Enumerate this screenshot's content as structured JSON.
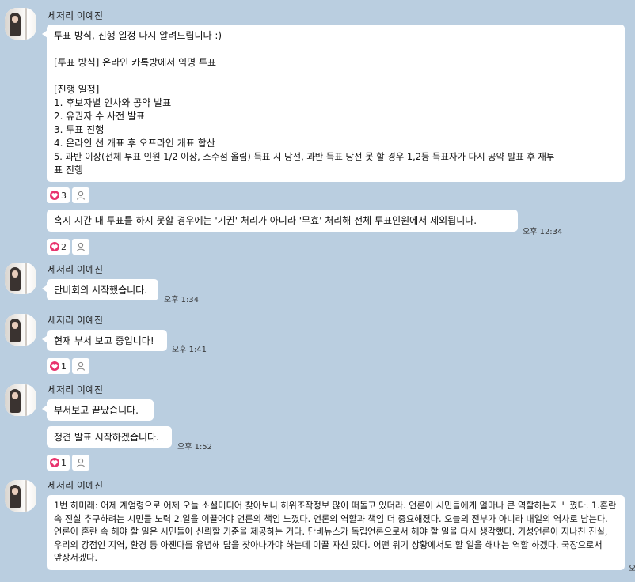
{
  "sender_name": "세저리 이예진",
  "groups": {
    "g1": {
      "msg1": {
        "lines": [
          "투표 방식, 진행 일정 다시 알려드립니다 :)",
          "",
          "[투표 방식] 온라인 카톡방에서 익명 투표",
          "",
          "[진행 일정]",
          "1. 후보자별 인사와 공약 발표",
          "2. 유권자 수 사전 발표",
          "3. 투표 진행",
          "4. 온라인 선 개표 후 오프라인 개표 합산",
          "5. 과반 이상(전체 투표 인원 1/2 이상, 소수점 올림) 득표 시 당선, 과반 득표 당선 못 할 경우 1,2등 득표자가 다시 공약 발표 후 재투",
          "표 진행"
        ],
        "heart_count": "3"
      },
      "msg2": {
        "text": "혹시 시간 내 투표를 하지 못할 경우에는 '기권' 처리가 아니라 '무효' 처리해 전체 투표인원에서 제외됩니다.",
        "time": "오후 12:34",
        "heart_count": "2"
      }
    },
    "g2": {
      "msg1": {
        "text": "단비회의 시작했습니다.",
        "time": "오후 1:34"
      }
    },
    "g3": {
      "msg1": {
        "text": "현재 부서 보고 중입니다!",
        "time": "오후 1:41",
        "heart_count": "1"
      }
    },
    "g4": {
      "msg1": {
        "text": "부서보고 끝났습니다."
      },
      "msg2": {
        "text": "정견 발표 시작하겠습니다.",
        "time": "오후 1:52",
        "heart_count": "1"
      }
    },
    "g5": {
      "msg1": {
        "text": "1번 하미래: 어제 계엄령으로 어제 오늘 소셜미디어 찾아보니 허위조작정보 많이 떠돌고 있더라. 언론이 시민들에게 얼마나 큰 역할하는지 느꼈다. 1.혼란 속 진실 추구하려는 시민들 노력 2.일을 이끌어야 언론의 책임 느꼈다. 언론의 역할과 책임 더 중요해졌다. 오늘의 전부가 아니라 내일의 역사로 남는다. 언론이 혼란 속 해야 할 일은 시민들이 신뢰할 기준을 제공하는 거다. 단비뉴스가 독립언론으로서 해야 할 일을 다시 생각했다. 기성언론이 지나친 진실, 우리의 강점인 지역, 환경 등 아젠다를 유념해 답을 찾아나가야 하는데 이끌 자신 있다. 어떤 위기 상황에서도 할 일을 해내는 역할 하겠다. 국장으로서 앞장서겠다.",
        "time": "오"
      }
    }
  },
  "colors": {
    "background": "#bacee0",
    "bubble": "#ffffff",
    "heart": "#e8336e"
  },
  "icons": {
    "reaction_heart": "heart-icon",
    "reaction_add": "person-icon",
    "profile": "avatar"
  }
}
